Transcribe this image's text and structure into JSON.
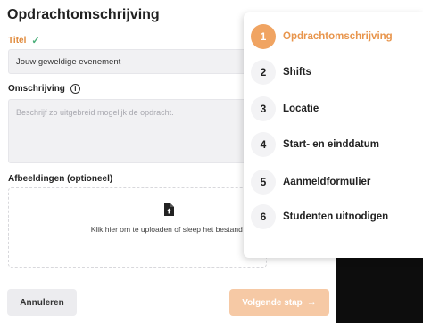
{
  "page": {
    "title": "Opdrachtomschrijving"
  },
  "form": {
    "title_label": "Titel",
    "title_value": "Jouw geweldige evenement",
    "description_label": "Omschrijving",
    "description_placeholder": "Beschrijf zo uitgebreid mogelijk de opdracht.",
    "images_label": "Afbeeldingen (optioneel)",
    "dropzone_text": "Klik hier om te uploaden of sleep het bestand erover"
  },
  "actions": {
    "cancel_label": "Annuleren",
    "next_label": "Volgende stap"
  },
  "steps": [
    {
      "number": "1",
      "label": "Opdrachtomschrijving",
      "active": true
    },
    {
      "number": "2",
      "label": "Shifts",
      "active": false
    },
    {
      "number": "3",
      "label": "Locatie",
      "active": false
    },
    {
      "number": "4",
      "label": "Start- en einddatum",
      "active": false
    },
    {
      "number": "5",
      "label": "Aanmeldformulier",
      "active": false
    },
    {
      "number": "6",
      "label": "Studenten uitnodigen",
      "active": false
    }
  ],
  "colors": {
    "accent": "#f0a462",
    "accent_text": "#e8954c",
    "next_button_disabled": "#f6c9a5",
    "valid_check": "#4caf7a"
  }
}
